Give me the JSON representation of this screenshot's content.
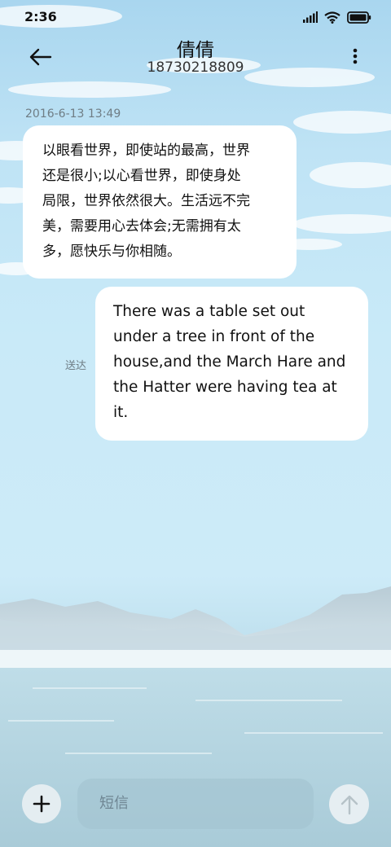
{
  "status_bar": {
    "time": "2:36",
    "icons": [
      "signal-icon",
      "wifi-icon",
      "battery-icon"
    ]
  },
  "header": {
    "title": "倩倩",
    "phone": "18730218809",
    "back_icon": "arrow-left-icon",
    "more_icon": "more-vertical-icon"
  },
  "conversation": {
    "timestamp": "2016-6-13 13:49",
    "received": {
      "lines": [
        "以眼看世界，即使站的最高，世界",
        "还是很小;以心看世界，即使身处",
        "局限，世界依然很大。生活远不完",
        "美，需要用心去体会;无需拥有太",
        "多，愿快乐与你相随。"
      ]
    },
    "sent": {
      "lines": [
        "There was a table set out",
        "under a tree in front of the",
        "house,and the March Hare and",
        "the Hatter were having tea at",
        "it."
      ],
      "status": "送达"
    }
  },
  "composer": {
    "placeholder": "短信",
    "add_icon": "plus-icon",
    "send_icon": "arrow-up-icon"
  },
  "colors": {
    "bubble": "#ffffff",
    "text": "#111111",
    "muted": "#6f7d85",
    "sky": "#c9eaf8",
    "input_bg": "#a4c4d2"
  }
}
